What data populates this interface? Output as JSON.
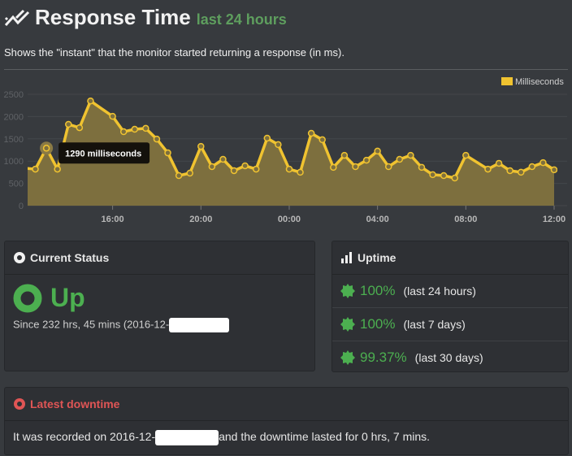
{
  "header": {
    "title": "Response Time",
    "subtitle": "last 24 hours",
    "description": "Shows the \"instant\" that the monitor started returning a response (in ms)."
  },
  "chart_data": {
    "type": "area",
    "legend": "top-right",
    "series": [
      {
        "name": "Milliseconds",
        "color": "#f0c330",
        "x": [
          "12:00",
          "12:30",
          "13:00",
          "13:30",
          "14:00",
          "14:30",
          "15:00",
          "16:00",
          "16:30",
          "17:00",
          "17:30",
          "18:00",
          "18:30",
          "19:00",
          "19:30",
          "20:00",
          "20:30",
          "21:00",
          "21:30",
          "22:00",
          "22:30",
          "23:00",
          "23:30",
          "00:00",
          "00:30",
          "01:00",
          "01:30",
          "02:00",
          "02:30",
          "03:00",
          "03:30",
          "04:00",
          "04:30",
          "05:00",
          "05:30",
          "06:00",
          "06:30",
          "07:00",
          "07:30",
          "08:00",
          "09:00",
          "09:30",
          "10:00",
          "10:30",
          "11:00",
          "11:30",
          "12:00"
        ],
        "values": [
          840,
          820,
          1290,
          820,
          1825,
          1750,
          2350,
          2005,
          1660,
          1715,
          1735,
          1495,
          1185,
          675,
          730,
          1330,
          875,
          1040,
          785,
          895,
          820,
          1515,
          1370,
          820,
          750,
          1625,
          1480,
          860,
          1130,
          875,
          1020,
          1225,
          875,
          1040,
          1130,
          860,
          695,
          675,
          620,
          1130,
          820,
          950,
          785,
          750,
          875,
          965,
          805
        ]
      }
    ],
    "yticks": [
      0,
      500,
      1000,
      1500,
      2000,
      2500
    ],
    "xticks": [
      "16:00",
      "20:00",
      "00:00",
      "04:00",
      "08:00",
      "12:00"
    ],
    "xlim": [
      "12:09",
      "12:00"
    ],
    "ylim": [
      0,
      2500
    ],
    "grid": true,
    "tooltip": {
      "point": "13:00",
      "text": "1290 milliseconds"
    }
  },
  "status": {
    "title": "Current Status",
    "state": "Up",
    "since": "Since 232 hrs, 45 mins (2016-12-",
    "color": "#4caf50"
  },
  "uptime": {
    "title": "Uptime",
    "rows": [
      {
        "pct": "100%",
        "label": "(last 24 hours)"
      },
      {
        "pct": "100%",
        "label": "(last 7 days)"
      },
      {
        "pct": "99.37%",
        "label": "(last 30 days)"
      }
    ]
  },
  "downtime": {
    "title": "Latest downtime",
    "text_a": "It was recorded on 2016-12-",
    "text_b": "and the downtime lasted for 0 hrs, 7 mins.",
    "color": "#e05555"
  }
}
